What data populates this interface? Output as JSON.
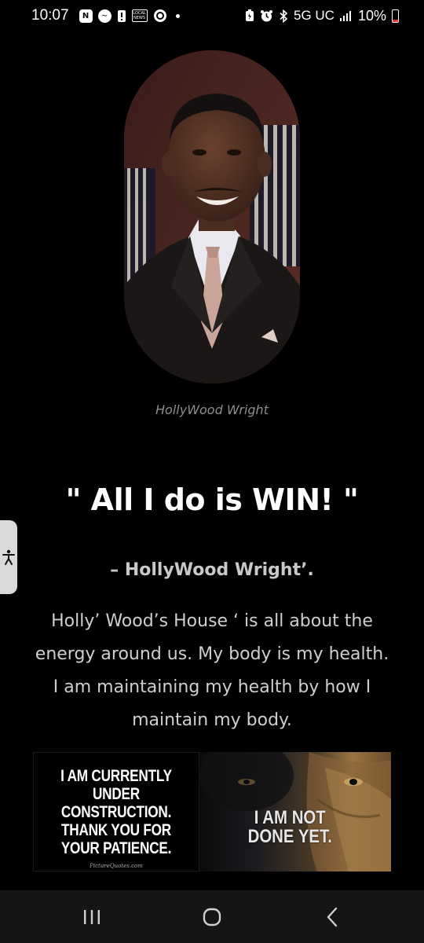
{
  "status_bar": {
    "time": "10:07",
    "network": "5G UC",
    "battery": "10%",
    "battery_color": "#e53935"
  },
  "profile": {
    "caption": "HollyWood Wright"
  },
  "quote": {
    "text": "\" All I do is WIN! \"",
    "author": "– HollyWood Wright’."
  },
  "body_text": "Holly’ Wood’s House ‘ is all about the energy around us. My body is my health. I am maintaining my health by how I maintain my body.",
  "images": {
    "left_text": "I AM CURRENTLY UNDER CONSTRUCTION. THANK YOU FOR YOUR PATIENCE.",
    "left_credit": "PictureQuotes.com",
    "right_text": "I AM NOT DONE YET."
  },
  "icons": {
    "accessibility": "accessibility-icon",
    "nav_recent": "recent-apps-icon",
    "nav_home": "home-icon",
    "nav_back": "back-icon"
  }
}
